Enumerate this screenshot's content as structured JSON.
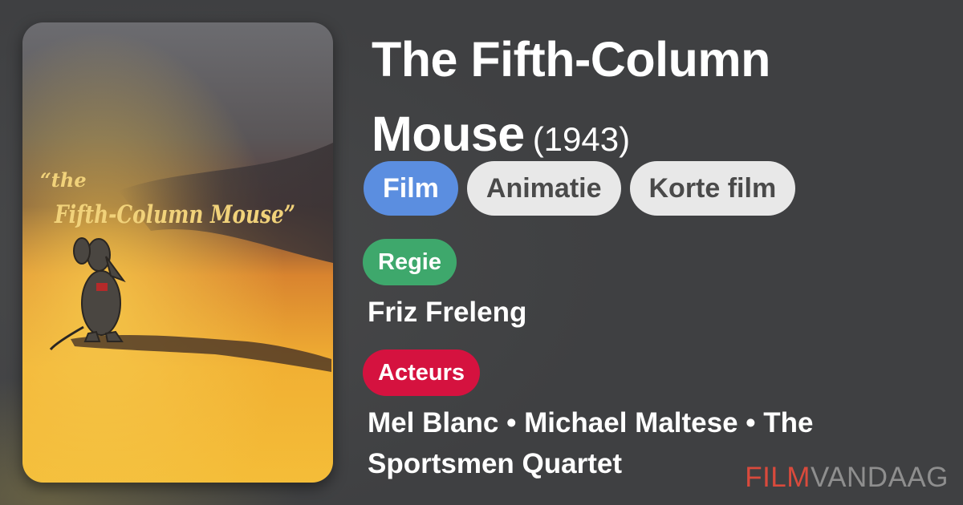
{
  "movie": {
    "title": "The Fifth-Column Mouse",
    "title_line1": "The Fifth-Column",
    "title_line2": "Mouse",
    "year": "(1943)"
  },
  "genres": [
    "Film",
    "Animatie",
    "Korte film"
  ],
  "director_section": {
    "label": "Regie",
    "names": "Friz Freleng"
  },
  "cast_section": {
    "label": "Acteurs",
    "line1": "Mel Blanc • Michael Maltese • The",
    "line2": "Sportsmen Quartet"
  },
  "poster": {
    "line1": "“the",
    "line2": "Fifth-Column Mouse”"
  },
  "logo": {
    "part1": "FILM",
    "part2": "VANDAAG"
  },
  "colors": {
    "film_chip": "#5b8ee0",
    "regie": "#3ea86c",
    "acteurs": "#d5123f",
    "logo_red": "#d94a3c"
  }
}
